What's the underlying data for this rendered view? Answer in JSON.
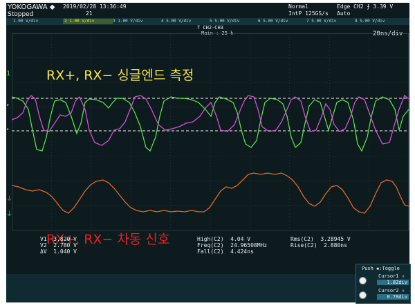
{
  "header": {
    "brand": "YOKOGAWA ◆",
    "status": "Stopped",
    "datetime": "2019/02/28 13:36:49",
    "acq_count": "21",
    "mode": "Normal",
    "sample_rate": "IntP 125GS/s",
    "trigger": "Edge CH2 ⨍ 3.39 V",
    "trigger_mode": "Auto"
  },
  "channels": [
    {
      "label": "1.00 V/div",
      "color": "#9ed6e8"
    },
    {
      "label": "2 1.00 V/div",
      "color": "#e8e84a"
    },
    {
      "label": "3 1.00 V/div",
      "color": "#b9d6dc"
    },
    {
      "label": "4 5.00 V/div",
      "color": "#b9d6dc"
    },
    {
      "label": "5 5.00 V/div",
      "color": "#b9d6dc"
    },
    {
      "label": "6 5.00 V/div",
      "color": "#b9d6dc"
    },
    {
      "label": "7 5.00 V/div",
      "color": "#b9d6dc"
    },
    {
      "label": "8 5.00 V/div",
      "color": "#b9d6dc"
    }
  ],
  "timebase": {
    "trigger_marker": "T CH2-CH3",
    "main_label": "Main : 25 k",
    "time_div": "20ns/div"
  },
  "annotations": {
    "single_ended": "RX+, RX− 싱글엔드 측정",
    "differential": "RX+, RX− 차동 신호"
  },
  "measurements": {
    "v1": "V1  3.820 V",
    "v2": "V2  2.780 V",
    "dv": "ΔV  1.040 V",
    "high": "High(C2)  4.04 V",
    "freq": "Freq(C2)  24.96508MHz",
    "fall": "Fall(C2)  4.424ns",
    "rms": "Rms(C2)  3.28945 V",
    "rise": "Rise(C2)  2.880ns"
  },
  "cursor_panel": {
    "title": "Push ◆:Toggle",
    "cursor1_label": "Cursor1 ⇳",
    "cursor1_value": "1.82div",
    "cursor2_label": "Cursor2 ⇳",
    "cursor2_value": "0.78div"
  },
  "colors": {
    "background": "#0d1b1f",
    "grid": "#3e5a60",
    "trace_green": "#59e04a",
    "trace_magenta": "#d84fd8",
    "trace_orange": "#e06a2a",
    "cursor_line": "#c8c8c8"
  }
}
